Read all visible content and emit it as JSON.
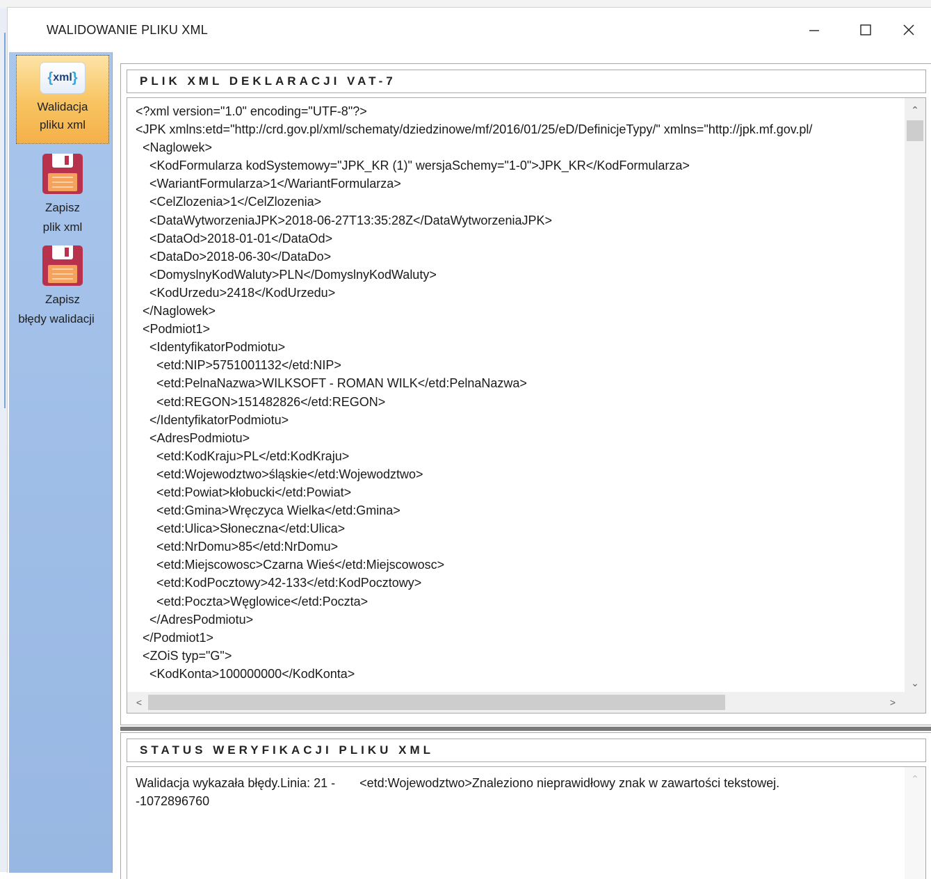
{
  "window": {
    "title": "WALIDOWANIE PLIKU XML",
    "controls": {
      "minimize": "—",
      "maximize": "☐",
      "close": "✕"
    }
  },
  "sidebar": {
    "items": [
      {
        "label_line1": "Walidacja",
        "label_line2": "pliku xml",
        "icon": "xml-icon",
        "active": true
      },
      {
        "label_line1": "Zapisz",
        "label_line2": "plik xml",
        "icon": "floppy-disk-icon",
        "active": false
      },
      {
        "label_line1": "Zapisz",
        "label_line2": "błędy walidacji",
        "icon": "floppy-disk-icon",
        "active": false
      }
    ],
    "xml_icon_text": "xml"
  },
  "xml_panel": {
    "header": "PLIK XML DEKLARACJI VAT-7",
    "content": "<?xml version=\"1.0\" encoding=\"UTF-8\"?>\n<JPK xmlns:etd=\"http://crd.gov.pl/xml/schematy/dziedzinowe/mf/2016/01/25/eD/DefinicjeTypy/\" xmlns=\"http://jpk.mf.gov.pl/\n  <Naglowek>\n    <KodFormularza kodSystemowy=\"JPK_KR (1)\" wersjaSchemy=\"1-0\">JPK_KR</KodFormularza>\n    <WariantFormularza>1</WariantFormularza>\n    <CelZlozenia>1</CelZlozenia>\n    <DataWytworzeniaJPK>2018-06-27T13:35:28Z</DataWytworzeniaJPK>\n    <DataOd>2018-01-01</DataOd>\n    <DataDo>2018-06-30</DataDo>\n    <DomyslnyKodWaluty>PLN</DomyslnyKodWaluty>\n    <KodUrzedu>2418</KodUrzedu>\n  </Naglowek>\n  <Podmiot1>\n    <IdentyfikatorPodmiotu>\n      <etd:NIP>5751001132</etd:NIP>\n      <etd:PelnaNazwa>WILKSOFT - ROMAN WILK</etd:PelnaNazwa>\n      <etd:REGON>151482826</etd:REGON>\n    </IdentyfikatorPodmiotu>\n    <AdresPodmiotu>\n      <etd:KodKraju>PL</etd:KodKraju>\n      <etd:Wojewodztwo>śląskie</etd:Wojewodztwo>\n      <etd:Powiat>kłobucki</etd:Powiat>\n      <etd:Gmina>Wręczyca Wielka</etd:Gmina>\n      <etd:Ulica>Słoneczna</etd:Ulica>\n      <etd:NrDomu>85</etd:NrDomu>\n      <etd:Miejscowosc>Czarna Wieś</etd:Miejscowosc>\n      <etd:KodPocztowy>42-133</etd:KodPocztowy>\n      <etd:Poczta>Węglowice</etd:Poczta>\n    </AdresPodmiotu>\n  </Podmiot1>\n  <ZOiS typ=\"G\">\n    <KodKonta>100000000</KodKonta>"
  },
  "status_panel": {
    "header": "STATUS WERYFIKACJI PLIKU XML",
    "message": "Walidacja wykazała błędy.Linia: 21 -       <etd:Wojewodztwo>Znaleziono nieprawidłowy znak w zawartości tekstowej.\n-1072896760"
  },
  "scroll": {
    "up": "⌃",
    "down": "⌄",
    "left": "<",
    "right": ">"
  }
}
